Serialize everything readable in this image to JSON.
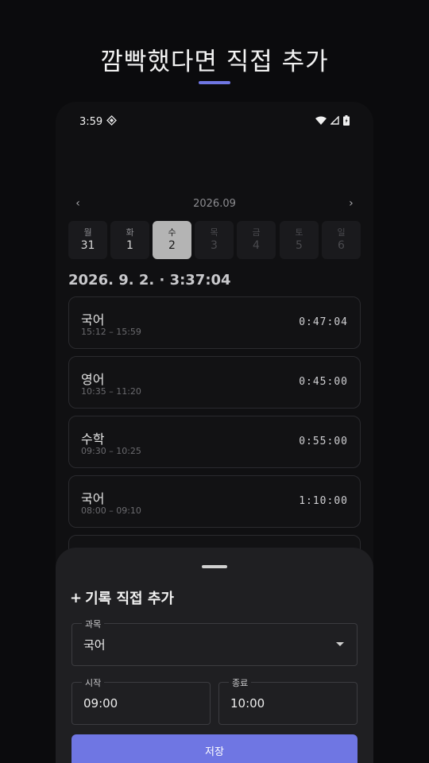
{
  "headline": "깜빡했다면 직접 추가",
  "colors": {
    "accent": "#6f76e3",
    "background": "#0b0b0d",
    "card": "#121214",
    "sheet": "#1f1f22"
  },
  "status_bar": {
    "time": "3:59",
    "left_icon": "location-diamond-icon",
    "right_icons": [
      "wifi-icon",
      "signal-icon",
      "battery-charging-icon"
    ]
  },
  "calendar": {
    "month_label": "2026.09",
    "prev_icon": "‹",
    "next_icon": "›",
    "days": [
      {
        "name": "월",
        "num": "31",
        "state": "past"
      },
      {
        "name": "화",
        "num": "1",
        "state": "past"
      },
      {
        "name": "수",
        "num": "2",
        "state": "selected"
      },
      {
        "name": "목",
        "num": "3",
        "state": "future"
      },
      {
        "name": "금",
        "num": "4",
        "state": "future"
      },
      {
        "name": "토",
        "num": "5",
        "state": "future"
      },
      {
        "name": "일",
        "num": "6",
        "state": "future"
      }
    ]
  },
  "date_heading": "2026. 9. 2. · 3:37:04",
  "records": [
    {
      "subject": "국어",
      "range": "15:12 – 15:59",
      "duration": "0:47:04"
    },
    {
      "subject": "영어",
      "range": "10:35 – 11:20",
      "duration": "0:45:00"
    },
    {
      "subject": "수학",
      "range": "09:30 – 10:25",
      "duration": "0:55:00"
    },
    {
      "subject": "국어",
      "range": "08:00 – 09:10",
      "duration": "1:10:00"
    }
  ],
  "sheet": {
    "title_icon": "+",
    "title": "기록 직접 추가",
    "subject_label": "과목",
    "subject_value": "국어",
    "start_label": "시작",
    "start_value": "09:00",
    "end_label": "종료",
    "end_value": "10:00",
    "save_label": "저장"
  }
}
